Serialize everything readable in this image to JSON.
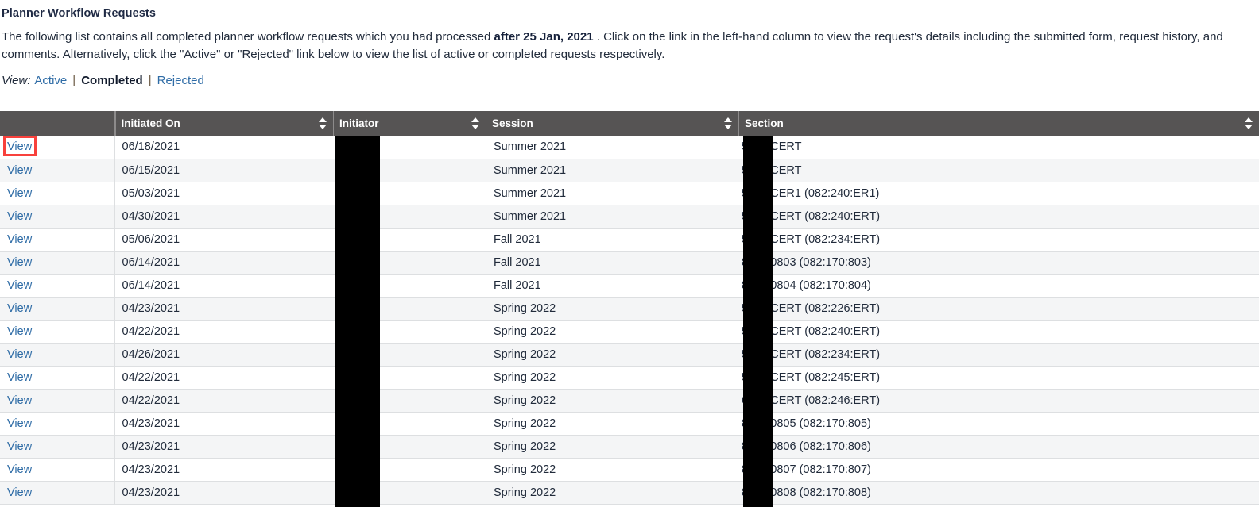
{
  "page": {
    "title": "Planner Workflow Requests",
    "intro_part1": "The following list contains all completed planner workflow requests which you had processed ",
    "intro_bold": "after 25 Jan, 2021",
    "intro_part2": " . Click on the link in the left-hand column to view the request's details including the submitted form, request history, and comments. Alternatively, click the \"Active\" or \"Rejected\" link below to view the list of active or completed requests respectively."
  },
  "viewbar": {
    "label": "View:",
    "active_label": "Active",
    "separator": "|",
    "completed_label": "Completed",
    "rejected_label": "Rejected"
  },
  "table": {
    "columns": [
      {
        "key": "view",
        "label": "",
        "sortable": false
      },
      {
        "key": "date",
        "label": "Initiated On",
        "sortable": true
      },
      {
        "key": "init",
        "label": "Initiator",
        "sortable": true
      },
      {
        "key": "session",
        "label": "Session",
        "sortable": true
      },
      {
        "key": "section",
        "label": "Section",
        "sortable": true
      }
    ],
    "row_link_label": "View",
    "rows": [
      {
        "link": "View",
        "date": "06/18/2021",
        "initiator": "",
        "session": "Summer 2021",
        "section": "5127:CERT"
      },
      {
        "link": "View",
        "date": "06/15/2021",
        "initiator": "",
        "session": "Summer 2021",
        "section": "5127:CERT"
      },
      {
        "link": "View",
        "date": "05/03/2021",
        "initiator": "",
        "session": "Summer 2021",
        "section": "5140:CER1 (082:240:ER1)"
      },
      {
        "link": "View",
        "date": "04/30/2021",
        "initiator": "",
        "session": "Summer 2021",
        "section": "5140:CERT (082:240:ERT)"
      },
      {
        "link": "View",
        "date": "05/06/2021",
        "initiator": "",
        "session": "Fall 2021",
        "section": "5234:CERT (082:234:ERT)"
      },
      {
        "link": "View",
        "date": "06/14/2021",
        "initiator": "",
        "session": "Fall 2021",
        "section": "8370:0803 (082:170:803)"
      },
      {
        "link": "View",
        "date": "06/14/2021",
        "initiator": "",
        "session": "Fall 2021",
        "section": "8370:0804 (082:170:804)"
      },
      {
        "link": "View",
        "date": "04/23/2021",
        "initiator": "",
        "session": "Spring 2022",
        "section": "5126:CERT (082:226:ERT)"
      },
      {
        "link": "View",
        "date": "04/22/2021",
        "initiator": "",
        "session": "Spring 2022",
        "section": "5140:CERT (082:240:ERT)"
      },
      {
        "link": "View",
        "date": "04/26/2021",
        "initiator": "",
        "session": "Spring 2022",
        "section": "5234:CERT (082:234:ERT)"
      },
      {
        "link": "View",
        "date": "04/22/2021",
        "initiator": "",
        "session": "Spring 2022",
        "section": "5245:CERT (082:245:ERT)"
      },
      {
        "link": "View",
        "date": "04/22/2021",
        "initiator": "",
        "session": "Spring 2022",
        "section": "6246:CERT (082:246:ERT)"
      },
      {
        "link": "View",
        "date": "04/23/2021",
        "initiator": "",
        "session": "Spring 2022",
        "section": "8370:0805 (082:170:805)"
      },
      {
        "link": "View",
        "date": "04/23/2021",
        "initiator": "",
        "session": "Spring 2022",
        "section": "8370:0806 (082:170:806)"
      },
      {
        "link": "View",
        "date": "04/23/2021",
        "initiator": "",
        "session": "Spring 2022",
        "section": "8370:0807 (082:170:807)"
      },
      {
        "link": "View",
        "date": "04/23/2021",
        "initiator": "",
        "session": "Spring 2022",
        "section": "8370:0808 (082:170:808)"
      }
    ]
  },
  "colors": {
    "header_bg": "#565454",
    "link": "#2f6ca6",
    "row_alt": "#f4f5f6",
    "highlight": "#f8413c",
    "redaction": "#000000"
  }
}
